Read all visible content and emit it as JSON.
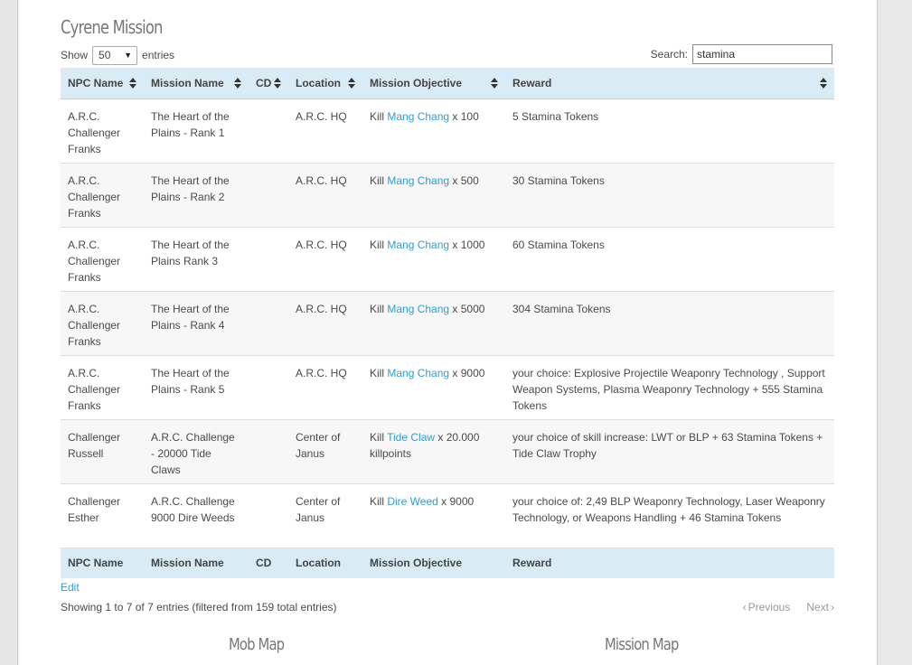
{
  "title": "Cyrene Mission",
  "length": {
    "show": "Show",
    "value": "50",
    "entries": "entries"
  },
  "search": {
    "label": "Search:",
    "value": "stamina"
  },
  "columns": [
    "NPC Name",
    "Mission Name",
    "CD",
    "Location",
    "Mission Objective",
    "Reward"
  ],
  "rows": [
    {
      "npc": "A.R.C. Challenger Franks",
      "mission": "The Heart of the Plains - Rank 1",
      "cd": "",
      "location": "A.R.C. HQ",
      "obj_pre": "Kill ",
      "obj_link": "Mang Chang",
      "obj_post": " x 100",
      "reward": "5 Stamina Tokens"
    },
    {
      "npc": "A.R.C. Challenger Franks",
      "mission": "The Heart of the Plains - Rank 2",
      "cd": "",
      "location": "A.R.C. HQ",
      "obj_pre": "Kill ",
      "obj_link": "Mang Chang",
      "obj_post": " x 500",
      "reward": "30 Stamina Tokens"
    },
    {
      "npc": "A.R.C. Challenger Franks",
      "mission": "The Heart of the Plains  Rank 3",
      "cd": "",
      "location": "A.R.C. HQ",
      "obj_pre": "Kill ",
      "obj_link": "Mang Chang",
      "obj_post": " x 1000",
      "reward": "60 Stamina Tokens"
    },
    {
      "npc": "A.R.C. Challenger Franks",
      "mission": "The Heart of the Plains - Rank 4",
      "cd": "",
      "location": "A.R.C. HQ",
      "obj_pre": "Kill ",
      "obj_link": "Mang Chang",
      "obj_post": " x 5000",
      "reward": "304 Stamina Tokens"
    },
    {
      "npc": "A.R.C. Challenger Franks",
      "mission": "The Heart of the Plains - Rank 5",
      "cd": "",
      "location": "A.R.C. HQ",
      "obj_pre": "Kill ",
      "obj_link": "Mang Chang",
      "obj_post": " x 9000",
      "reward": "your choice: Explosive Projectile Weaponry Technology , Support Weapon Systems, Plasma Weaponry Technology + 555 Stamina Tokens"
    },
    {
      "npc": "Challenger Russell",
      "mission": "A.R.C. Challenge - 20000 Tide Claws",
      "cd": "",
      "location": "Center of Janus",
      "obj_pre": "Kill ",
      "obj_link": "Tide Claw",
      "obj_post": " x 20.000 killpoints",
      "reward": "your choice of skill increase: LWT or BLP + 63 Stamina Tokens + Tide Claw Trophy"
    },
    {
      "npc": "Challenger Esther",
      "mission": "A.R.C. Challenge 9000 Dire Weeds",
      "cd": "",
      "location": "Center of Janus",
      "obj_pre": "Kill ",
      "obj_link": "Dire Weed",
      "obj_post": " x 9000",
      "reward": "your choice of: 2,49 BLP Weaponry Technology, Laser Weaponry Technology, or Weapons Handling + 46 Stamina Tokens"
    }
  ],
  "edit": "Edit",
  "info": "Showing 1 to 7 of 7 entries (filtered from 159 total entries)",
  "pager": {
    "previous": "Previous",
    "next": "Next"
  },
  "maps": {
    "mob": "Mob Map",
    "mission": "Mission Map"
  },
  "colors": {
    "header_bg": "#d9ebf5",
    "link": "#2a9fd6"
  }
}
